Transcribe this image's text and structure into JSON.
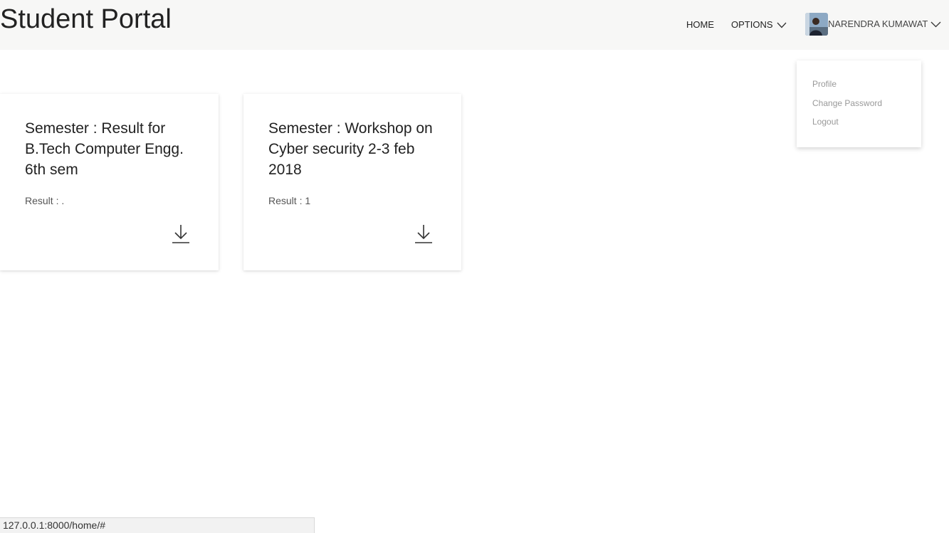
{
  "header": {
    "brand": "Student Portal",
    "nav": {
      "home": "HOME",
      "options": "OPTIONS",
      "user_name": "NARENDRA KUMAWAT"
    }
  },
  "user_menu": {
    "items": [
      "Profile",
      "Change Password",
      "Logout"
    ]
  },
  "cards": [
    {
      "title": "Semester : Result for B.Tech Computer Engg. 6th sem",
      "result": "Result : .",
      "icon": "download-icon"
    },
    {
      "title": "Semester : Workshop on Cyber security 2-3 feb 2018",
      "result": "Result : 1",
      "icon": "download-icon"
    }
  ],
  "status_url": "127.0.0.1:8000/home/#",
  "colors": {
    "navbar_bg": "#f7f7f6",
    "menu_text": "#999999",
    "card_bg": "#ffffff"
  }
}
